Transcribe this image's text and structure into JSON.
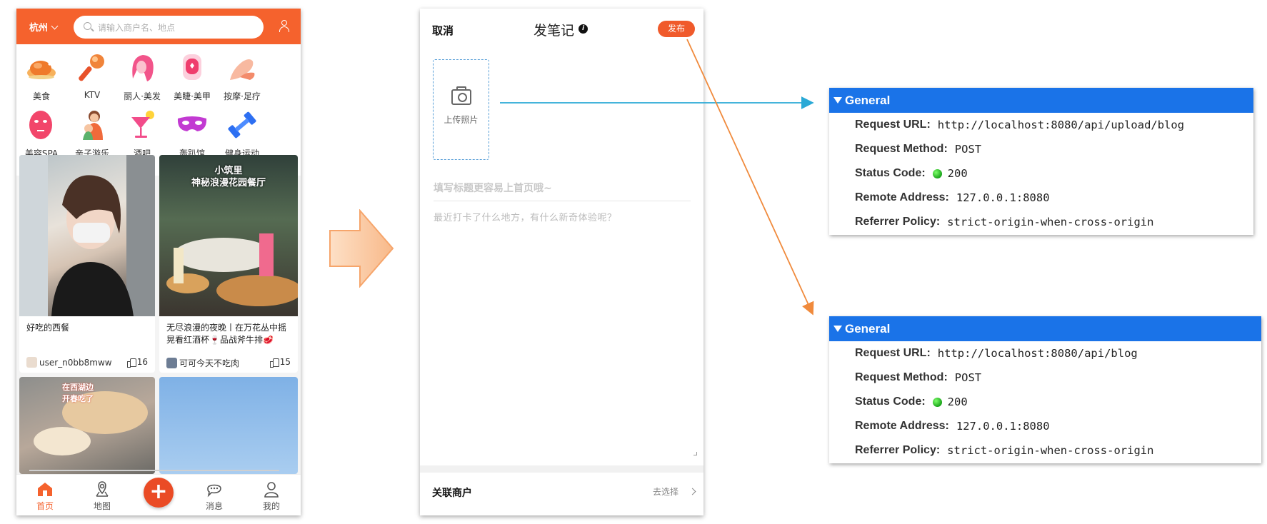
{
  "phone1": {
    "city": "杭州",
    "search_placeholder": "请输入商户名、地点",
    "categories": [
      {
        "label": "美食",
        "icon": "roast-chicken-icon"
      },
      {
        "label": "KTV",
        "icon": "microphone-icon"
      },
      {
        "label": "丽人·美发",
        "icon": "hair-icon"
      },
      {
        "label": "美睫·美甲",
        "icon": "nail-icon"
      },
      {
        "label": "按摩·足疗",
        "icon": "massage-hand-icon"
      },
      {
        "label": "美容SPA",
        "icon": "face-mask-icon"
      },
      {
        "label": "亲子游乐",
        "icon": "parent-child-icon"
      },
      {
        "label": "酒吧",
        "icon": "cocktail-icon"
      },
      {
        "label": "轰趴馆",
        "icon": "party-mask-icon"
      },
      {
        "label": "健身运动",
        "icon": "dumbbell-icon"
      }
    ],
    "cards": [
      {
        "title": "好吃的西餐",
        "author": "user_n0bb8mww",
        "likes": "16"
      },
      {
        "image_text_1": "小筑里",
        "image_text_2": "神秘浪漫花园餐厅",
        "title": "无尽浪漫的夜晚丨在万花丛中摇晃看红酒杯🍷品战斧牛排🥩",
        "author": "可可今天不吃肉",
        "likes": "15"
      },
      {
        "image_text_1": "在西湖边",
        "image_text_2": "开春吃了"
      },
      {}
    ],
    "tabs": [
      {
        "label": "首页",
        "icon": "home-icon"
      },
      {
        "label": "地图",
        "icon": "map-pin-icon"
      },
      {
        "label": "",
        "icon": "plus-icon"
      },
      {
        "label": "消息",
        "icon": "message-icon"
      },
      {
        "label": "我的",
        "icon": "profile-icon"
      }
    ]
  },
  "phone2": {
    "cancel": "取消",
    "title": "发笔记",
    "info": "i",
    "publish": "发布",
    "upload_label": "上传照片",
    "title_placeholder": "填写标题更容易上首页哦~",
    "body_placeholder": "最近打卡了什么地方，有什么新奇体验呢？",
    "shop_label": "关联商户",
    "shop_choose": "去选择"
  },
  "panels": [
    {
      "header": "General",
      "rows": [
        {
          "key": "Request URL:",
          "value": "http://localhost:8080/api/upload/blog"
        },
        {
          "key": "Request Method:",
          "value": "POST"
        },
        {
          "key": "Status Code:",
          "value": "200"
        },
        {
          "key": "Remote Address:",
          "value": "127.0.0.1:8080"
        },
        {
          "key": "Referrer Policy:",
          "value": "strict-origin-when-cross-origin"
        }
      ]
    },
    {
      "header": "General",
      "rows": [
        {
          "key": "Request URL:",
          "value": "http://localhost:8080/api/blog"
        },
        {
          "key": "Request Method:",
          "value": "POST"
        },
        {
          "key": "Status Code:",
          "value": "200"
        },
        {
          "key": "Remote Address:",
          "value": "127.0.0.1:8080"
        },
        {
          "key": "Referrer Policy:",
          "value": "strict-origin-when-cross-origin"
        }
      ]
    }
  ],
  "colors": {
    "brand_orange": "#f5622d",
    "devtools_blue": "#1a73e8",
    "status_green": "#22b022",
    "arrow_cyan": "#2aa9d6",
    "arrow_orange": "#f08a3c"
  }
}
